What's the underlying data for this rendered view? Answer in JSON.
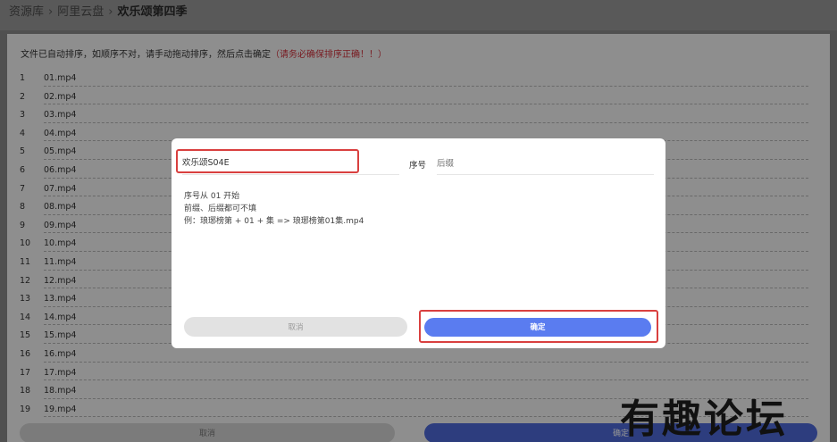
{
  "breadcrumb": {
    "root": "资源库",
    "middle": "阿里云盘",
    "current": "欢乐颂第四季"
  },
  "notice": {
    "text": "文件已自动排序，如顺序不对，请手动拖动排序，然后点击确定",
    "warning": "（请务必确保排序正确！！）"
  },
  "files": [
    {
      "num": "1",
      "name": "01.mp4"
    },
    {
      "num": "2",
      "name": "02.mp4"
    },
    {
      "num": "3",
      "name": "03.mp4"
    },
    {
      "num": "4",
      "name": "04.mp4"
    },
    {
      "num": "5",
      "name": "05.mp4"
    },
    {
      "num": "6",
      "name": "06.mp4"
    },
    {
      "num": "7",
      "name": "07.mp4"
    },
    {
      "num": "8",
      "name": "08.mp4"
    },
    {
      "num": "9",
      "name": "09.mp4"
    },
    {
      "num": "10",
      "name": "10.mp4"
    },
    {
      "num": "11",
      "name": "11.mp4"
    },
    {
      "num": "12",
      "name": "12.mp4"
    },
    {
      "num": "13",
      "name": "13.mp4"
    },
    {
      "num": "14",
      "name": "14.mp4"
    },
    {
      "num": "15",
      "name": "15.mp4"
    },
    {
      "num": "16",
      "name": "16.mp4"
    },
    {
      "num": "17",
      "name": "17.mp4"
    },
    {
      "num": "18",
      "name": "18.mp4"
    },
    {
      "num": "19",
      "name": "19.mp4"
    }
  ],
  "bottom": {
    "cancel": "取消",
    "ok": "确定"
  },
  "modal": {
    "prefix_value": "欢乐颂S04E",
    "seq_label": "序号",
    "suffix_placeholder": "后缀",
    "hints": [
      "序号从 01 开始",
      "前缀、后缀都可不填",
      "例：琅琊榜第 + 01 + 集 => 琅琊榜第01集.mp4"
    ],
    "cancel": "取消",
    "ok": "确定"
  },
  "watermark": "有趣论坛",
  "colors": {
    "accent": "#5a7cf0",
    "highlight_border": "#d9403f",
    "warning_text": "#d0313b"
  }
}
